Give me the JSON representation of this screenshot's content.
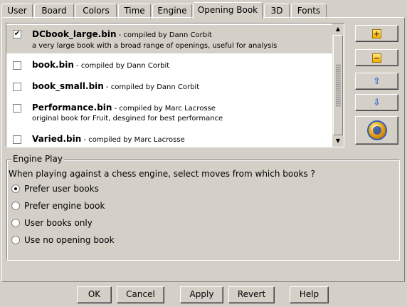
{
  "tabs": [
    "User",
    "Board",
    "Colors",
    "Time",
    "Engine",
    "Opening Book",
    "3D",
    "Fonts"
  ],
  "active_tab": "Opening Book",
  "books": [
    {
      "name": "DCbook_large.bin",
      "by": " - compiled by Dann Corbit",
      "desc": "a very large book with a broad range of openings, useful for analysis",
      "checked": true,
      "selected": true
    },
    {
      "name": "book.bin",
      "by": " - compiled by Dann Corbit",
      "desc": "",
      "checked": false
    },
    {
      "name": "book_small.bin",
      "by": " - compiled by Dann Corbit",
      "desc": "",
      "checked": false
    },
    {
      "name": "Performance.bin",
      "by": " - compiled by Marc Lacrosse",
      "desc": "original book for Fruit, desgined for best performance",
      "checked": false
    },
    {
      "name": "Varied.bin",
      "by": " - compiled by Marc Lacrosse",
      "desc": "",
      "checked": false
    }
  ],
  "checkmark": "✔",
  "side_buttons": {
    "add_icon": "plus-icon",
    "remove_icon": "minus-icon",
    "up_icon": "arrow-up-icon",
    "down_icon": "arrow-down-icon",
    "refresh_icon": "globe-refresh-icon"
  },
  "engine_play": {
    "title": "Engine Play",
    "question": "When playing against a chess engine, select moves from which books ?",
    "options": [
      "Prefer user books",
      "Prefer engine book",
      "User books only",
      "Use no opening book"
    ],
    "selected_index": 0
  },
  "buttons": {
    "ok": "OK",
    "cancel": "Cancel",
    "apply": "Apply",
    "revert": "Revert",
    "help": "Help"
  }
}
